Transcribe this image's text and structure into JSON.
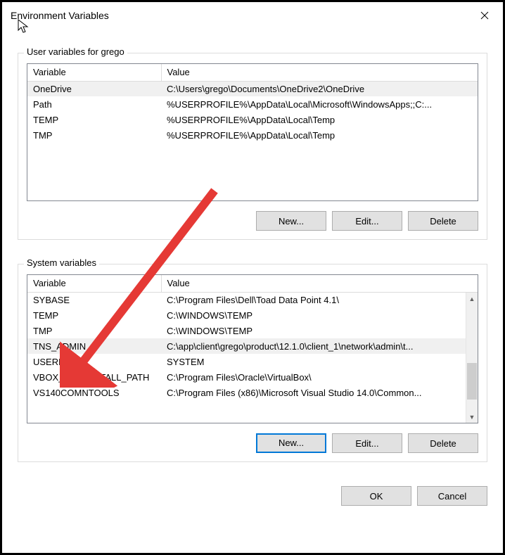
{
  "window": {
    "title": "Environment Variables"
  },
  "user_group": {
    "label": "User variables for grego",
    "columns": {
      "variable": "Variable",
      "value": "Value"
    },
    "rows": [
      {
        "variable": "OneDrive",
        "value": "C:\\Users\\grego\\Documents\\OneDrive2\\OneDrive",
        "highlight": true
      },
      {
        "variable": "Path",
        "value": "%USERPROFILE%\\AppData\\Local\\Microsoft\\WindowsApps;;C:..."
      },
      {
        "variable": "TEMP",
        "value": "%USERPROFILE%\\AppData\\Local\\Temp"
      },
      {
        "variable": "TMP",
        "value": "%USERPROFILE%\\AppData\\Local\\Temp"
      }
    ],
    "buttons": {
      "new": "New...",
      "edit": "Edit...",
      "delete": "Delete"
    }
  },
  "system_group": {
    "label": "System variables",
    "columns": {
      "variable": "Variable",
      "value": "Value"
    },
    "rows": [
      {
        "variable": "SYBASE",
        "value": "C:\\Program Files\\Dell\\Toad Data Point 4.1\\"
      },
      {
        "variable": "TEMP",
        "value": "C:\\WINDOWS\\TEMP"
      },
      {
        "variable": "TMP",
        "value": "C:\\WINDOWS\\TEMP"
      },
      {
        "variable": "TNS_ADMIN",
        "value": "C:\\app\\client\\grego\\product\\12.1.0\\client_1\\network\\admin\\t...",
        "highlight": true
      },
      {
        "variable": "USERNAME",
        "value": "SYSTEM"
      },
      {
        "variable": "VBOX_MSI_INSTALL_PATH",
        "value": "C:\\Program Files\\Oracle\\VirtualBox\\"
      },
      {
        "variable": "VS140COMNTOOLS",
        "value": "C:\\Program Files (x86)\\Microsoft Visual Studio 14.0\\Common..."
      }
    ],
    "buttons": {
      "new": "New...",
      "edit": "Edit...",
      "delete": "Delete"
    }
  },
  "dialog_buttons": {
    "ok": "OK",
    "cancel": "Cancel"
  }
}
